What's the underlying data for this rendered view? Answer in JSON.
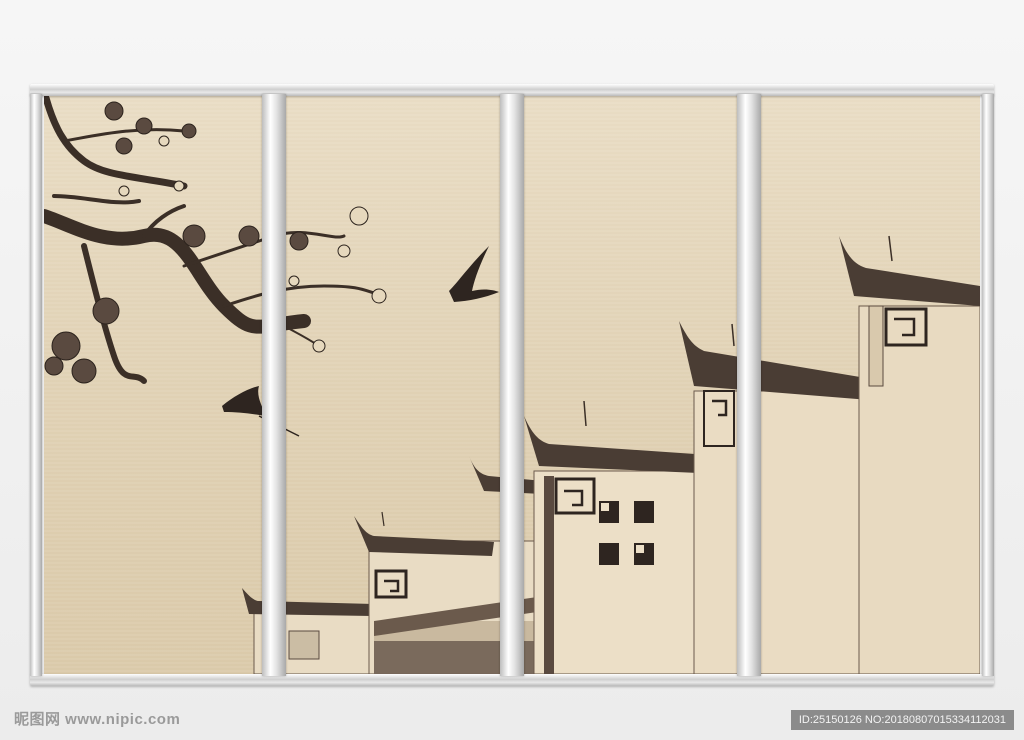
{
  "watermark": {
    "text": "昵图网 www.nipic.com"
  },
  "image_id": {
    "text": "ID:25150126 NO:20180807015334112031"
  },
  "colors": {
    "paper": "#e6d8bd",
    "ink": "#3a2e26",
    "blossom": "#5a4a40",
    "wall": "#e9dcc4",
    "roof": "#4a3d34"
  }
}
